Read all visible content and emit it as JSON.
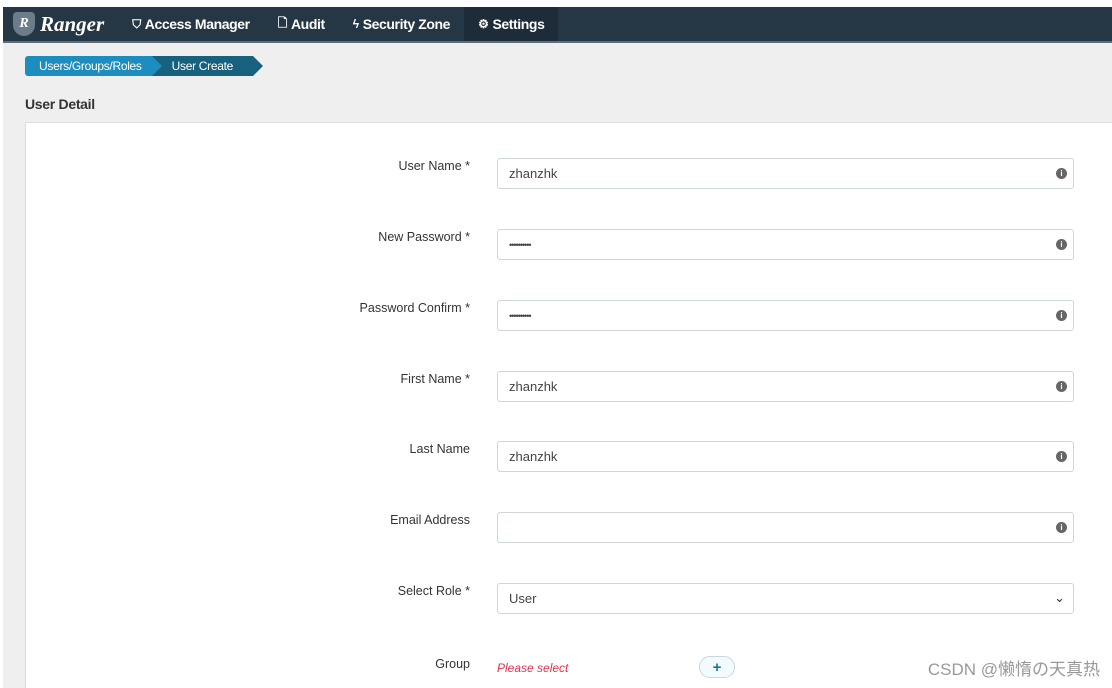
{
  "nav": {
    "brand": "Ranger",
    "items": [
      {
        "label": "Access Manager",
        "icon": "shield-icon"
      },
      {
        "label": "Audit",
        "icon": "file-icon"
      },
      {
        "label": "Security Zone",
        "icon": "bolt-icon"
      },
      {
        "label": "Settings",
        "icon": "gear-icon",
        "active": true
      }
    ]
  },
  "breadcrumb": [
    "Users/Groups/Roles",
    "User Create"
  ],
  "title": "User Detail",
  "form": {
    "user_name": {
      "label": "User Name *",
      "value": "zhanzhk"
    },
    "new_password": {
      "label": "New Password *",
      "value": "••••••••••"
    },
    "password_confirm": {
      "label": "Password Confirm *",
      "value": "••••••••••"
    },
    "first_name": {
      "label": "First Name *",
      "value": "zhanzhk"
    },
    "last_name": {
      "label": "Last Name",
      "value": "zhanzhk"
    },
    "email": {
      "label": "Email Address",
      "value": ""
    },
    "role": {
      "label": "Select Role *",
      "value": "User"
    },
    "group": {
      "label": "Group",
      "placeholder": "Please select",
      "add": "+"
    }
  },
  "watermark": "CSDN @懒惰の天真热"
}
